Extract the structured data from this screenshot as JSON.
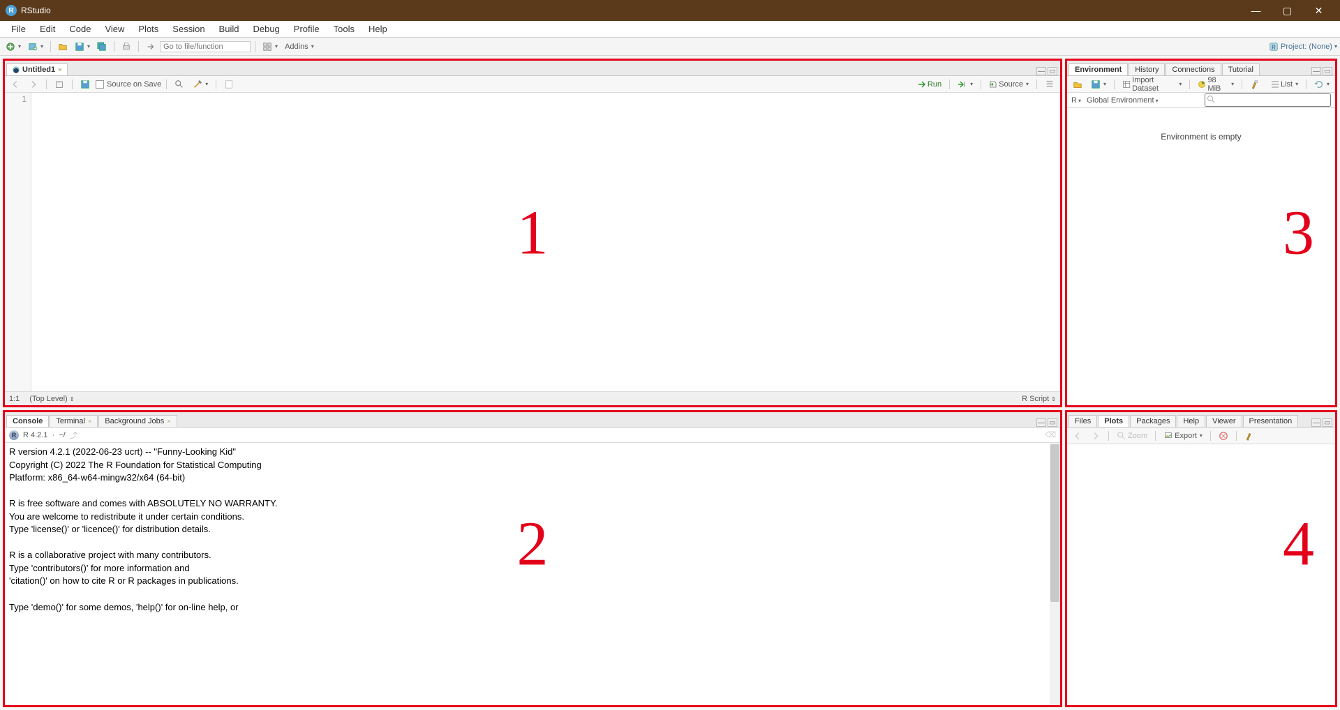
{
  "titlebar": {
    "app_name": "RStudio"
  },
  "menu": [
    "File",
    "Edit",
    "Code",
    "View",
    "Plots",
    "Session",
    "Build",
    "Debug",
    "Profile",
    "Tools",
    "Help"
  ],
  "gtoolbar": {
    "goto_placeholder": "Go to file/function",
    "addins_label": "Addins",
    "project_label": "Project: (None)"
  },
  "source": {
    "tab_label": "Untitled1",
    "source_on_save": "Source on Save",
    "run": "Run",
    "source_btn": "Source",
    "line1": "1",
    "status_pos": "1:1",
    "status_scope": "(Top Level)",
    "status_lang": "R Script"
  },
  "console": {
    "tabs": [
      "Console",
      "Terminal",
      "Background Jobs"
    ],
    "r_version": "R 4.2.1",
    "r_path": "~/",
    "output": "R version 4.2.1 (2022-06-23 ucrt) -- \"Funny-Looking Kid\"\nCopyright (C) 2022 The R Foundation for Statistical Computing\nPlatform: x86_64-w64-mingw32/x64 (64-bit)\n\nR is free software and comes with ABSOLUTELY NO WARRANTY.\nYou are welcome to redistribute it under certain conditions.\nType 'license()' or 'licence()' for distribution details.\n\nR is a collaborative project with many contributors.\nType 'contributors()' for more information and\n'citation()' on how to cite R or R packages in publications.\n\nType 'demo()' for some demos, 'help()' for on-line help, or"
  },
  "env": {
    "tabs": [
      "Environment",
      "History",
      "Connections",
      "Tutorial"
    ],
    "import_label": "Import Dataset",
    "mem_label": "98 MiB",
    "list_label": "List",
    "r_label": "R",
    "ge_label": "Global Environment",
    "empty": "Environment is empty"
  },
  "plots": {
    "tabs": [
      "Files",
      "Plots",
      "Packages",
      "Help",
      "Viewer",
      "Presentation"
    ],
    "zoom": "Zoom",
    "export": "Export"
  },
  "overlays": {
    "n1": "1",
    "n2": "2",
    "n3": "3",
    "n4": "4"
  }
}
